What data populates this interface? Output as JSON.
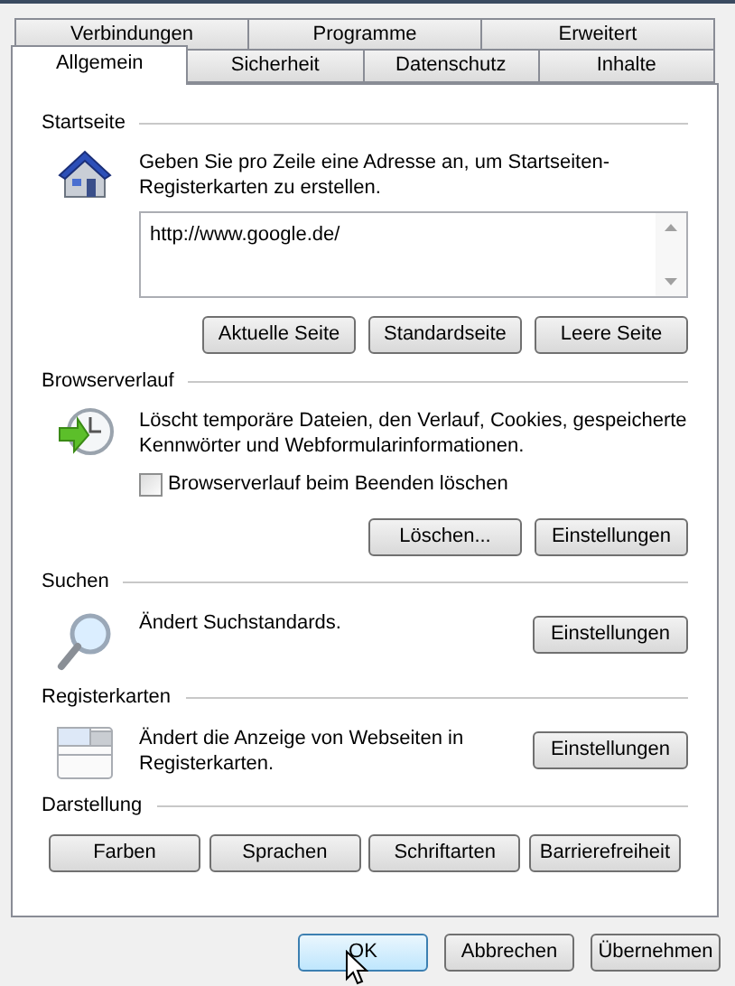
{
  "tab_rows": [
    [
      {
        "label": "Verbindungen",
        "selected": false
      },
      {
        "label": "Programme",
        "selected": false
      },
      {
        "label": "Erweitert",
        "selected": false
      }
    ],
    [
      {
        "label": "Allgemein",
        "selected": true
      },
      {
        "label": "Sicherheit",
        "selected": false
      },
      {
        "label": "Datenschutz",
        "selected": false
      },
      {
        "label": "Inhalte",
        "selected": false
      }
    ]
  ],
  "sections": [
    {
      "title": "Startseite",
      "description": "Geben Sie pro Zeile eine Adresse an, um Startseiten-Registerkarten zu erstellen.",
      "field": {
        "value": "http://www.google.de/"
      },
      "buttons": [
        "Aktuelle Seite",
        "Standardseite",
        "Leere Seite"
      ]
    },
    {
      "title": "Browserverlauf",
      "description": "Löscht temporäre Dateien, den Verlauf, Cookies, gespeicherte Kennwörter und Webformularinformationen.",
      "checkbox": {
        "label": "Browserverlauf beim Beenden löschen",
        "checked": false
      },
      "buttons": [
        "Löschen...",
        "Einstellungen"
      ]
    },
    {
      "title": "Suchen",
      "description": "Ändert Suchstandards.",
      "side_button": "Einstellungen"
    },
    {
      "title": "Registerkarten",
      "description": "Ändert die Anzeige von Webseiten in Registerkarten.",
      "side_button": "Einstellungen"
    },
    {
      "title": "Darstellung",
      "buttons": [
        "Farben",
        "Sprachen",
        "Schriftarten",
        "Barrierefreiheit"
      ]
    }
  ],
  "footer_buttons": [
    {
      "label": "OK",
      "focused": true
    },
    {
      "label": "Abbrechen",
      "focused": false
    },
    {
      "label": "Übernehmen",
      "focused": false
    }
  ]
}
